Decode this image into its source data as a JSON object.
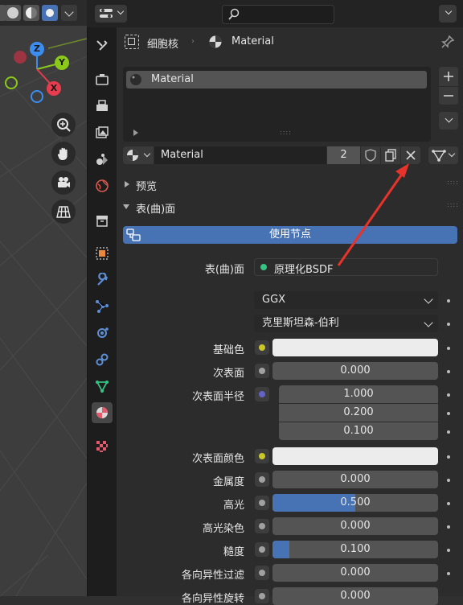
{
  "breadcrumb": {
    "object": "细胞核",
    "material": "Material"
  },
  "material_slots": [
    {
      "label": "Material"
    }
  ],
  "datablock": {
    "name": "Material",
    "users": "2"
  },
  "panels": {
    "preview": "预览",
    "surface": "表(曲)面"
  },
  "use_nodes_button": "使用节点",
  "surface_shader": {
    "label": "表(曲)面",
    "value": "原理化BSDF"
  },
  "distribution": "GGX",
  "subsurface_method": "克里斯坦森-伯利",
  "properties": [
    {
      "label": "基础色",
      "value": "",
      "socket_color": "#c7c729"
    },
    {
      "label": "次表面",
      "value": "0.000",
      "socket_color": "#a1a1a1"
    },
    {
      "label": "次表面半径",
      "values": [
        "1.000",
        "0.200",
        "0.100"
      ],
      "socket_color": "#6363c7"
    },
    {
      "label": "次表面颜色",
      "value": "",
      "socket_color": "#c7c729"
    },
    {
      "label": "金属度",
      "value": "0.000",
      "socket_color": "#a1a1a1"
    },
    {
      "label": "高光",
      "value": "0.500",
      "fraction": 0.5,
      "socket_color": "#a1a1a1"
    },
    {
      "label": "高光染色",
      "value": "0.000",
      "socket_color": "#a1a1a1"
    },
    {
      "label": "糙度",
      "value": "0.100",
      "fraction": 0.1,
      "socket_color": "#a1a1a1"
    },
    {
      "label": "各向异性过滤",
      "value": "0.000",
      "socket_color": "#a1a1a1"
    },
    {
      "label": "各向异性旋转",
      "value": "0.000",
      "socket_color": "#a1a1a1"
    }
  ],
  "gizmo": {
    "z": "Z",
    "y": "Y",
    "x": "X"
  },
  "colors": {
    "accent_blue": "#4772b3",
    "annotation_red": "#e8332b",
    "gizmo_x": "#e63c4e",
    "gizmo_y": "#8bc91a",
    "gizmo_z": "#3d8df0"
  }
}
